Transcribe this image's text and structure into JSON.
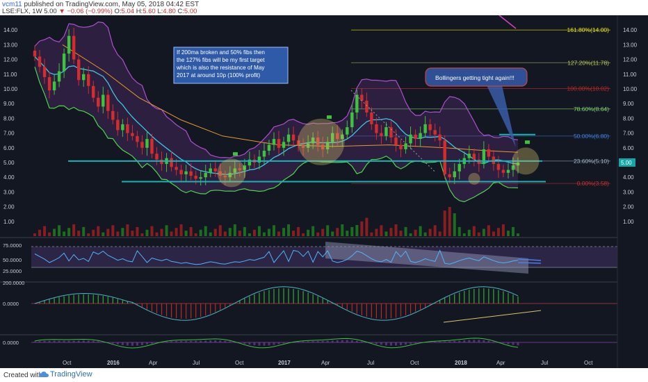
{
  "header": {
    "user": "vcm11",
    "published": "published on TradingView.com, May 05, 2018 04:42 EST",
    "symbol": "LSE:FLX, 1W",
    "last": "5.00",
    "change": "▼ −0.06 (−0.99%)",
    "open_label": "O:",
    "open": "5.04",
    "high_label": "H:",
    "high": "5.60",
    "low_label": "L:",
    "low": "4.80",
    "close_label": "C:",
    "close": "5.00"
  },
  "footer": {
    "created_with": "Created with",
    "brand": "TradingView"
  },
  "annotations": {
    "note1": [
      "If 200ma broken and 50% fibs then",
      "the 127% fibs will be my first target",
      "which is also the resistance of May",
      "2017 at around 10p (100% profit)"
    ],
    "note2": "Bollingers getting tight again!!!"
  },
  "chart_data": {
    "type": "candlestick",
    "main": {
      "ylim": [
        0,
        15
      ],
      "y_ticks": [
        "1.00",
        "2.00",
        "3.00",
        "4.00",
        "5.00",
        "6.00",
        "7.00",
        "8.00",
        "9.00",
        "10.00",
        "11.00",
        "12.00",
        "13.00",
        "14.00"
      ],
      "price_label": "5.00",
      "fib_levels": [
        {
          "label": "161.80%(14.00)",
          "value": 14.0,
          "color": "#e6e600"
        },
        {
          "label": "127.20%(11.78)",
          "value": 11.78,
          "color": "#b5c75a"
        },
        {
          "label": "100.00%(10.02)",
          "value": 10.02,
          "color": "#c62828"
        },
        {
          "label": "78.60%(8.64)",
          "value": 8.64,
          "color": "#7cd66c"
        },
        {
          "label": "50.00%(6.80)",
          "value": 6.8,
          "color": "#3f7fe0"
        },
        {
          "label": "23.60%(5.10)",
          "value": 5.1,
          "color": "#9fb3c8"
        },
        {
          "label": "0.00%(3.58)",
          "value": 3.58,
          "color": "#d32f2f"
        }
      ],
      "x_ticks": [
        "Oct",
        "2016",
        "Apr",
        "Jul",
        "Oct",
        "2017",
        "Apr",
        "Jul",
        "Oct",
        "2018",
        "Apr",
        "Jul",
        "Oct"
      ],
      "ohlc_close_approx": [
        12.2,
        11.5,
        10.8,
        9.9,
        10.5,
        11.2,
        12.4,
        13.6,
        12.0,
        10.6,
        11.0,
        10.2,
        9.4,
        8.8,
        9.6,
        8.5,
        7.9,
        7.2,
        7.6,
        7.0,
        6.8,
        6.4,
        6.0,
        6.6,
        5.6,
        5.2,
        4.9,
        5.3,
        4.7,
        4.5,
        4.2,
        4.4,
        4.1,
        3.9,
        4.0,
        4.3,
        4.6,
        4.4,
        4.1,
        4.0,
        4.3,
        4.6,
        4.5,
        4.8,
        5.2,
        5.0,
        5.4,
        5.8,
        6.2,
        6.6,
        6.0,
        6.4,
        6.9,
        6.5,
        6.2,
        6.0,
        6.3,
        6.7,
        6.2,
        5.9,
        6.4,
        7.0,
        6.6,
        6.9,
        7.4,
        8.4,
        9.6,
        9.2,
        8.4,
        7.6,
        7.0,
        6.8,
        7.4,
        6.7,
        6.2,
        5.9,
        6.3,
        6.9,
        6.6,
        7.0,
        7.6,
        7.2,
        6.9,
        6.5,
        4.2,
        4.0,
        4.4,
        4.9,
        5.3,
        5.6,
        5.2,
        4.9,
        5.9,
        5.4,
        4.9,
        4.5,
        4.3,
        4.5,
        4.8,
        5.0
      ]
    },
    "indicators": [
      {
        "name": "RSI",
        "ticks": [
          "75.0000",
          "50.0000",
          "25.0000"
        ]
      },
      {
        "name": "MACD",
        "ticks": [
          "200.0000",
          "0.0000"
        ]
      },
      {
        "name": "Oscillator",
        "ticks": [
          "0.0000"
        ]
      }
    ]
  }
}
